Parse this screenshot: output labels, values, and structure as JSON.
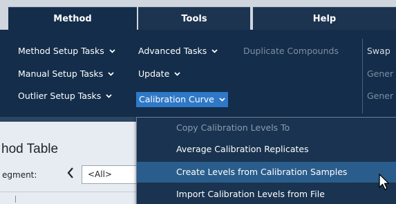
{
  "tabs": [
    {
      "label": "Method",
      "active": true
    },
    {
      "label": "Tools",
      "active": false
    },
    {
      "label": "Help",
      "active": false
    }
  ],
  "ribbon": {
    "method_setup_tasks": "Method Setup Tasks",
    "manual_setup_tasks": "Manual Setup Tasks",
    "outlier_setup_tasks": "Outlier Setup Tasks",
    "advanced_tasks": "Advanced Tasks",
    "update": "Update",
    "calibration_curve": "Calibration Curve",
    "duplicate_compounds": "Duplicate Compounds",
    "swap": "Swap",
    "gener_1": "Gener",
    "gener_2": "Gener",
    "chevron": "❯"
  },
  "main": {
    "title": "hod Table",
    "segment_label": "egment:",
    "segment_value": "<All>"
  },
  "menu": {
    "items": [
      {
        "label": "Copy Calibration Levels To",
        "enabled": false
      },
      {
        "label": "Average Calibration Replicates",
        "enabled": true
      },
      {
        "label": "Create Levels from Calibration Samples",
        "enabled": true,
        "hovered": true
      },
      {
        "label": "Import Calibration Levels from File",
        "enabled": true
      }
    ]
  },
  "colors": {
    "ribbon_bg": "#132d4a",
    "selected_bg": "#2e78c7",
    "menu_bg": "#193350",
    "menu_hover": "#2a5d8c"
  },
  "icons": {
    "chevron_down": "chevron-down-icon",
    "chevron_left": "chevron-left-icon",
    "cursor": "mouse-pointer-icon"
  }
}
